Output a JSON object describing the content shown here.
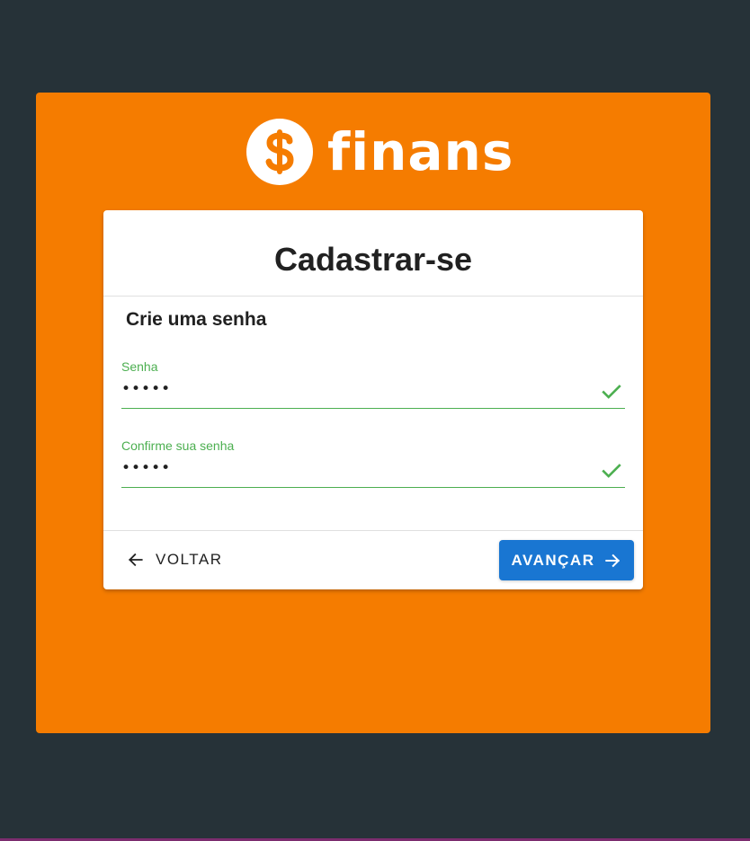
{
  "brand": {
    "name": "finans",
    "logo_icon": "dollar-coin-icon",
    "primary_color": "#f57c00",
    "background_color": "#263238"
  },
  "card": {
    "title": "Cadastrar-se",
    "subtitle": "Crie uma senha"
  },
  "fields": [
    {
      "label": "Senha",
      "value": "•••••",
      "status": "valid",
      "status_icon": "check-icon"
    },
    {
      "label": "Confirme sua senha",
      "value": "•••••",
      "status": "valid",
      "status_icon": "check-icon"
    }
  ],
  "actions": {
    "back_label": "VOLTAR",
    "back_icon": "arrow-left-icon",
    "next_label": "AVANÇAR",
    "next_icon": "arrow-right-icon",
    "next_color": "#1976d2"
  },
  "colors": {
    "valid": "#4caf50"
  }
}
